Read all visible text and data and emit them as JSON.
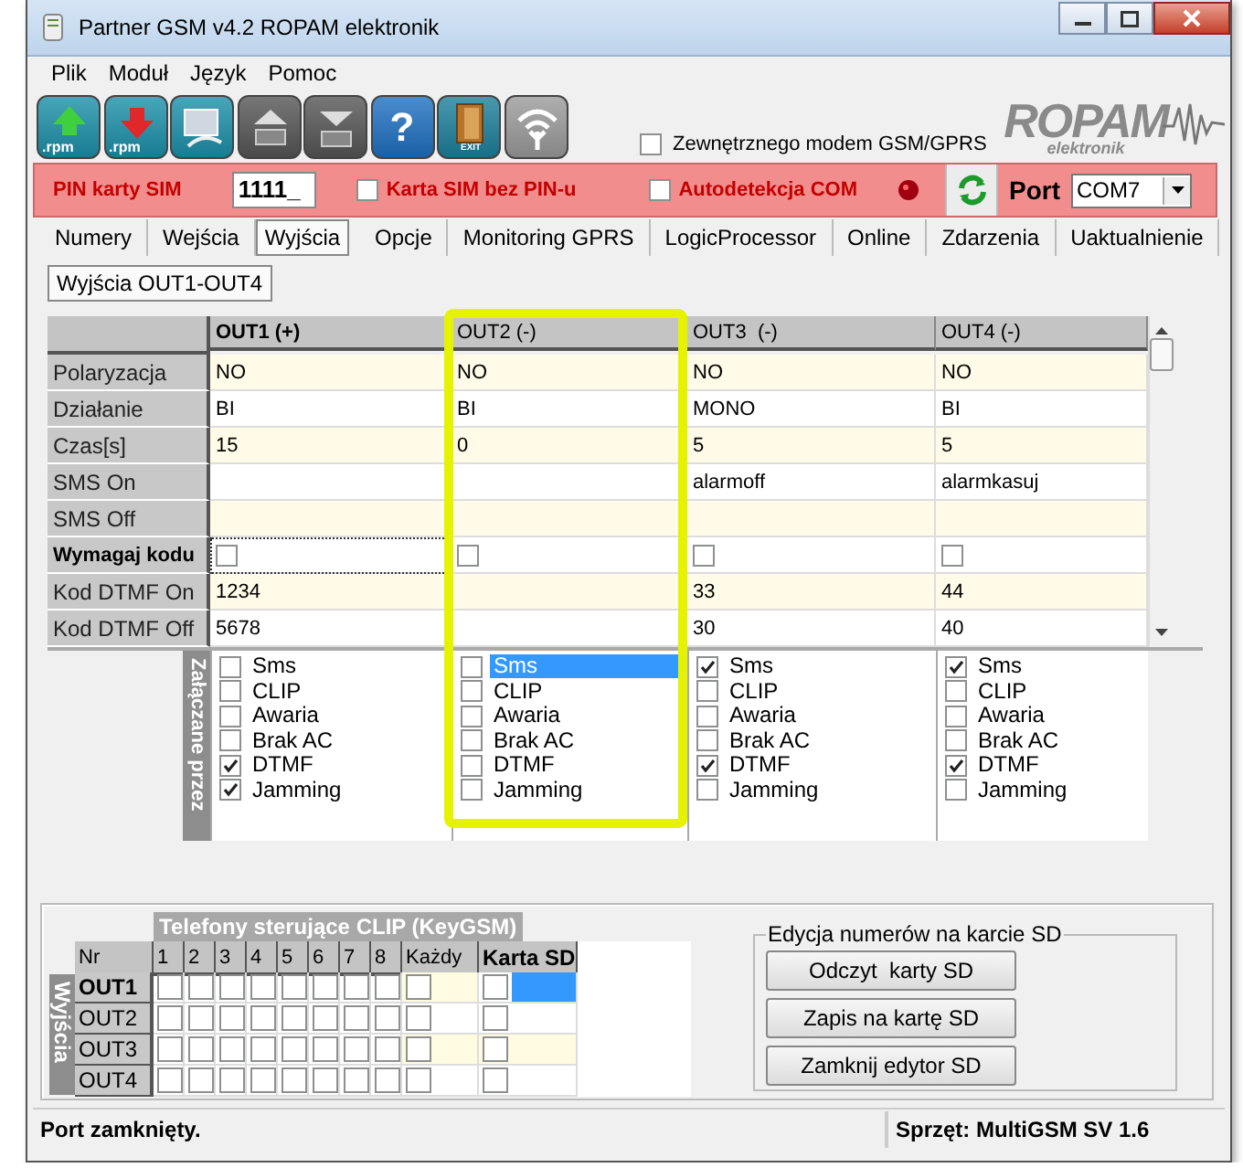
{
  "window": {
    "title": "Partner GSM v4.2 ROPAM elektronik"
  },
  "menu": [
    "Plik",
    "Moduł",
    "Język",
    "Pomoc"
  ],
  "toolbar": {
    "buttons": [
      {
        "kind": "upload",
        "label": ".rpm",
        "disabled": false
      },
      {
        "kind": "download",
        "label": ".rpm",
        "disabled": false
      },
      {
        "kind": "connect",
        "disabled": false
      },
      {
        "kind": "device-up",
        "disabled": true
      },
      {
        "kind": "device-down",
        "disabled": true
      },
      {
        "kind": "help",
        "label": "?",
        "disabled": false
      },
      {
        "kind": "exit",
        "label": "EXIT",
        "disabled": false
      },
      {
        "kind": "antenna",
        "disabled": false
      }
    ],
    "external_modem": {
      "label": "Zewnętrznego modem GSM/GPRS",
      "checked": false
    }
  },
  "logo": {
    "name": "ROPAM",
    "sub": "elektronik"
  },
  "sim": {
    "pin_label": "PIN karty SIM",
    "pin_value": "1111_",
    "no_pin": {
      "label": "Karta SIM bez PIN-u",
      "checked": false
    },
    "autodetect": {
      "label": "Autodetekcja COM",
      "checked": false
    },
    "port_label": "Port",
    "port_value": "COM7"
  },
  "tabs": [
    {
      "label": "Numery",
      "selected": false
    },
    {
      "label": "Wejścia",
      "selected": false
    },
    {
      "label": "Wyjścia",
      "selected": true
    },
    {
      "label": "Opcje",
      "selected": false
    },
    {
      "label": "Monitoring GPRS",
      "selected": false
    },
    {
      "label": "LogicProcessor",
      "selected": false
    },
    {
      "label": "Online",
      "selected": false
    },
    {
      "label": "Zdarzenia",
      "selected": false
    },
    {
      "label": "Uaktualnienie",
      "selected": false
    }
  ],
  "subtabs": [
    {
      "label": "Wyjścia OUT1-OUT4",
      "selected": true
    }
  ],
  "grid": {
    "columns": [
      {
        "label": "OUT1 (+)",
        "selected": true,
        "highlighted": false
      },
      {
        "label": "OUT2 (-)",
        "selected": false,
        "highlighted": true
      },
      {
        "label": "OUT3  (-)",
        "selected": false,
        "highlighted": false
      },
      {
        "label": "OUT4 (-)",
        "selected": false,
        "highlighted": false
      }
    ],
    "rows": [
      {
        "kind": "text",
        "label": "Polaryzacja",
        "selected": false,
        "cells": [
          "NO",
          "NO",
          "NO",
          "NO"
        ]
      },
      {
        "kind": "text",
        "label": "Działanie",
        "selected": false,
        "cells": [
          "BI",
          "BI",
          "MONO",
          "BI"
        ]
      },
      {
        "kind": "text",
        "label": "Czas[s]",
        "selected": false,
        "cells": [
          "15",
          "0",
          "5",
          "5"
        ]
      },
      {
        "kind": "text",
        "label": "SMS On",
        "selected": false,
        "cells": [
          null,
          null,
          "alarmoff",
          "alarmkasuj"
        ]
      },
      {
        "kind": "text",
        "label": "SMS Off",
        "selected": false,
        "cells": [
          null,
          null,
          null,
          null
        ]
      },
      {
        "kind": "check",
        "label": "Wymagaj kodu",
        "selected": true,
        "checked": [
          false,
          false,
          false,
          false
        ]
      },
      {
        "kind": "text",
        "label": "Kod DTMF On",
        "selected": false,
        "cells": [
          "1234",
          null,
          "33",
          "44"
        ]
      },
      {
        "kind": "text",
        "label": "Kod DTMF Off",
        "selected": false,
        "cells": [
          "5678",
          null,
          "30",
          "40"
        ]
      }
    ]
  },
  "triggers": {
    "label": "Załączane przez",
    "columns": [
      {
        "items": [
          {
            "label": "Sms",
            "checked": false,
            "selected": false
          },
          {
            "label": "CLIP",
            "checked": false,
            "selected": false
          },
          {
            "label": "Awaria",
            "checked": false,
            "selected": false
          },
          {
            "label": "Brak AC",
            "checked": false,
            "selected": false
          },
          {
            "label": "DTMF",
            "checked": true,
            "selected": false
          },
          {
            "label": "Jamming",
            "checked": true,
            "selected": false
          }
        ]
      },
      {
        "items": [
          {
            "label": "Sms",
            "checked": false,
            "selected": true
          },
          {
            "label": "CLIP",
            "checked": false,
            "selected": false
          },
          {
            "label": "Awaria",
            "checked": false,
            "selected": false
          },
          {
            "label": "Brak AC",
            "checked": false,
            "selected": false
          },
          {
            "label": "DTMF",
            "checked": false,
            "selected": false
          },
          {
            "label": "Jamming",
            "checked": false,
            "selected": false
          }
        ]
      },
      {
        "items": [
          {
            "label": "Sms",
            "checked": true,
            "selected": false
          },
          {
            "label": "CLIP",
            "checked": false,
            "selected": false
          },
          {
            "label": "Awaria",
            "checked": false,
            "selected": false
          },
          {
            "label": "Brak AC",
            "checked": false,
            "selected": false
          },
          {
            "label": "DTMF",
            "checked": true,
            "selected": false
          },
          {
            "label": "Jamming",
            "checked": false,
            "selected": false
          }
        ]
      },
      {
        "items": [
          {
            "label": "Sms",
            "checked": true,
            "selected": false
          },
          {
            "label": "CLIP",
            "checked": false,
            "selected": false
          },
          {
            "label": "Awaria",
            "checked": false,
            "selected": false
          },
          {
            "label": "Brak AC",
            "checked": false,
            "selected": false
          },
          {
            "label": "DTMF",
            "checked": true,
            "selected": false
          },
          {
            "label": "Jamming",
            "checked": false,
            "selected": false
          }
        ]
      }
    ]
  },
  "clip": {
    "title": "Telefony sterujące CLIP (KeyGSM)",
    "side_label": "Wyjścia",
    "corner": "Nr",
    "columns": [
      {
        "label": "1",
        "selected": false
      },
      {
        "label": "2",
        "selected": false
      },
      {
        "label": "3",
        "selected": false
      },
      {
        "label": "4",
        "selected": false
      },
      {
        "label": "5",
        "selected": false
      },
      {
        "label": "6",
        "selected": false
      },
      {
        "label": "7",
        "selected": false
      },
      {
        "label": "8",
        "selected": false
      },
      {
        "label": "Każdy",
        "selected": false
      },
      {
        "label": "Karta SD",
        "selected": true
      }
    ],
    "rows": [
      {
        "label": "OUT1",
        "selected": true,
        "checks": [
          false,
          false,
          false,
          false,
          false,
          false,
          false,
          false,
          false,
          false
        ]
      },
      {
        "label": "OUT2",
        "selected": false,
        "checks": [
          false,
          false,
          false,
          false,
          false,
          false,
          false,
          false,
          false,
          false
        ]
      },
      {
        "label": "OUT3",
        "selected": false,
        "checks": [
          false,
          false,
          false,
          false,
          false,
          false,
          false,
          false,
          false,
          false
        ]
      },
      {
        "label": "OUT4",
        "selected": false,
        "checks": [
          false,
          false,
          false,
          false,
          false,
          false,
          false,
          false,
          false,
          false
        ]
      }
    ]
  },
  "sd_editor": {
    "title": "Edycja numerów na karcie SD",
    "buttons": [
      "Odczyt  karty SD",
      "Zapis na kartę SD",
      "Zamknij edytor SD"
    ]
  },
  "status_bar": [
    "Port zamknięty.",
    "Sprzęt: MultiGSM SV 1.6"
  ]
}
